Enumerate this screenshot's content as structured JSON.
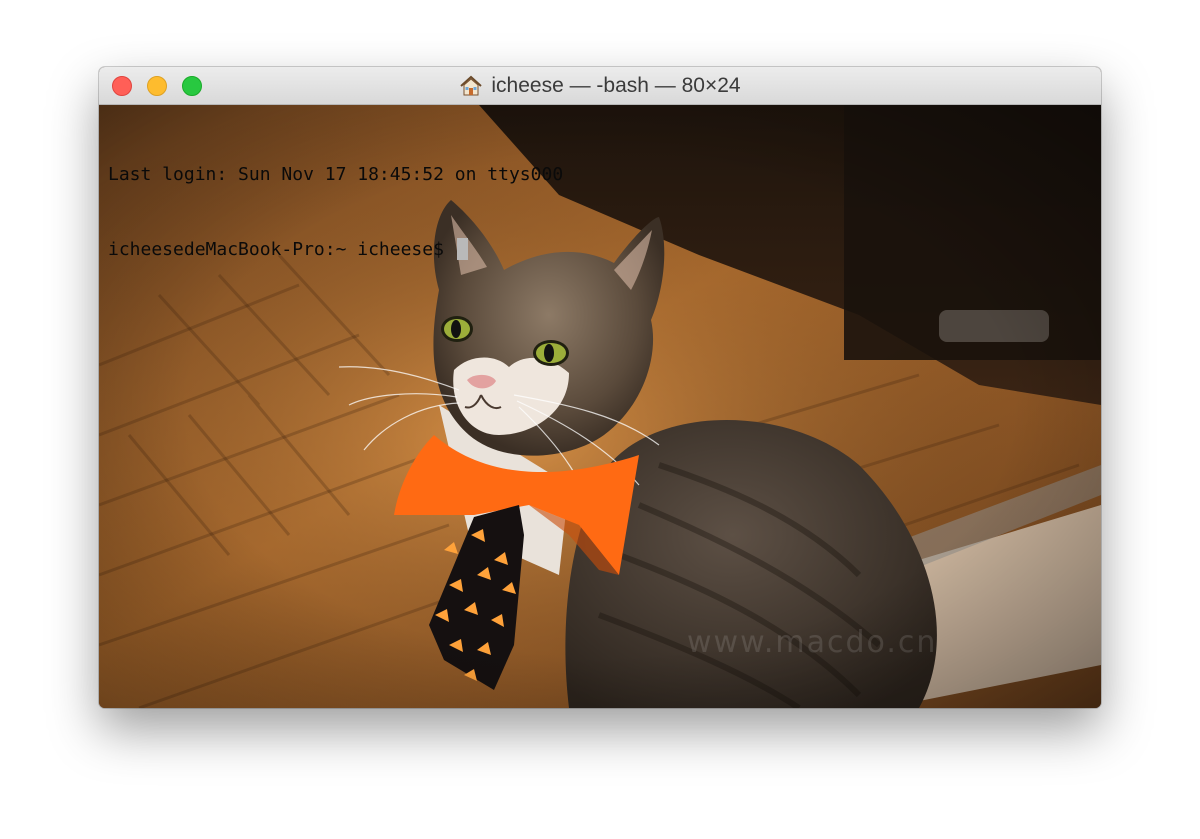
{
  "window": {
    "title": "icheese — -bash — 80×24",
    "title_icon": "home-icon",
    "buttons": {
      "close": "close-button",
      "minimize": "minimize-button",
      "zoom": "zoom-button"
    }
  },
  "terminal": {
    "lines": [
      "Last login: Sun Nov 17 18:45:52 on ttys000",
      "icheesedeMacBook-Pro:~ icheese$ "
    ],
    "cursor": "block-cursor"
  },
  "background": {
    "subject": "cat-with-orange-collar-and-candy-corn-tie",
    "watermark": "www.macdo.cn"
  },
  "colors": {
    "close": "#ff5f57",
    "minimize": "#febc2e",
    "zoom": "#28c840",
    "collar": "#ff6a13",
    "floor": "#b5651d"
  }
}
